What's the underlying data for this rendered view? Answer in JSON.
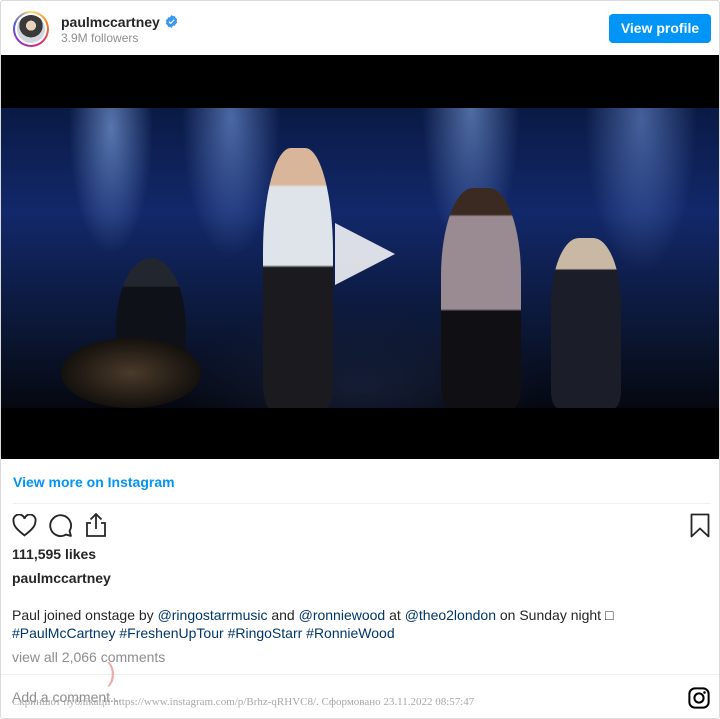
{
  "header": {
    "username": "paulmccartney",
    "followers": "3.9M followers",
    "view_profile_label": "View profile"
  },
  "icons": {
    "verified": "verified-badge-icon",
    "play": "play-icon",
    "like": "heart-icon",
    "comment": "comment-icon",
    "share": "share-icon",
    "save": "bookmark-icon",
    "instagram": "instagram-icon"
  },
  "colors": {
    "accent": "#0095f6",
    "link": "#00376b",
    "muted": "#8e8e8e"
  },
  "view_more_label": "View more on Instagram",
  "likes": "111,595 likes",
  "author": "paulmccartney",
  "caption": {
    "t1": "Paul joined onstage by ",
    "m1": "@ringostarrmusic",
    "t2": " and ",
    "m2": "@ronniewood",
    "t3": " at ",
    "m3": "@theo2london",
    "t4": " on Sunday night □",
    "h1": "#PaulMcCartney",
    "h2": "#FreshenUpTour",
    "h3": "#RingoStarr",
    "h4": "#RonnieWood"
  },
  "view_comments_label": "view all 2,066 comments",
  "add_comment_placeholder": "Add a comment...",
  "screenshot_note": "Скриншот публікації https://www.instagram.com/p/Brhz-qRHVC8/. Сформовано 23.11.2022 08:57:47"
}
